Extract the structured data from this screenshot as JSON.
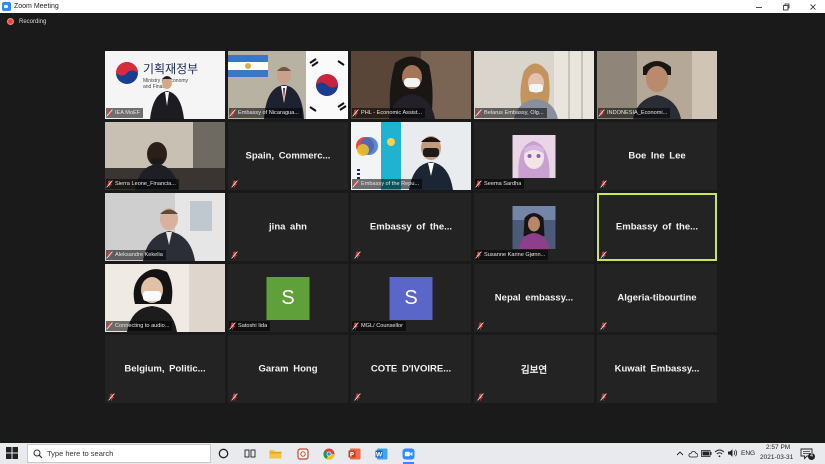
{
  "window": {
    "title": "Zoom Meeting"
  },
  "recording": {
    "label": "Recording",
    "color": "#e8473b"
  },
  "accent": {
    "active_speaker_border": "#c8e65a",
    "zoom_blue": "#2d8cff"
  },
  "tiles": [
    {
      "kind": "video",
      "scene": "ministry-logo",
      "caption": "IEA MoEF",
      "logo_text": "기획재정부",
      "logo_sub_1": "Ministry of Economy",
      "logo_sub_2": "and Finance"
    },
    {
      "kind": "video",
      "scene": "flags",
      "caption": "Embassy of Nicaragua..."
    },
    {
      "kind": "video",
      "scene": "woman-mask",
      "caption": "PHL - Economic Assist..."
    },
    {
      "kind": "video",
      "scene": "woman-room",
      "caption": "Belarus Embassy, Olg..."
    },
    {
      "kind": "video",
      "scene": "man-office",
      "caption": "INDONESIA_Economi..."
    },
    {
      "kind": "video",
      "scene": "man-dark",
      "caption": "Sierra Leone_Financia..."
    },
    {
      "kind": "name",
      "display": "Spain, Commerc..."
    },
    {
      "kind": "video",
      "scene": "man-flag-kz",
      "caption": "Embassy of the Repu..."
    },
    {
      "kind": "thumb",
      "scene": "anime",
      "caption": "Seema Sardha"
    },
    {
      "kind": "name",
      "display": "Boe Ine Lee"
    },
    {
      "kind": "video",
      "scene": "man-office-2",
      "caption": "Aleksandre Kekelia"
    },
    {
      "kind": "name",
      "display": "jina ahn"
    },
    {
      "kind": "name",
      "display": "Embassy of the..."
    },
    {
      "kind": "thumb",
      "scene": "woman-photo",
      "caption": "Susanne Karine Gjønn..."
    },
    {
      "kind": "name",
      "display": "Embassy of the...",
      "active": true
    },
    {
      "kind": "video",
      "scene": "woman-mask-2",
      "caption": "Connecting to audio..."
    },
    {
      "kind": "avatar",
      "letter": "S",
      "avatar_color": "#5fa03a",
      "caption": "Satoshi Iida"
    },
    {
      "kind": "avatar",
      "letter": "S",
      "avatar_color": "#5a67c8",
      "caption": "MGL/ Counsellor"
    },
    {
      "kind": "name",
      "display": "Nepal embassy..."
    },
    {
      "kind": "name",
      "display": "Algeria-tibourtine"
    },
    {
      "kind": "name",
      "display": "Belgium, Politic..."
    },
    {
      "kind": "name",
      "display": "Garam Hong"
    },
    {
      "kind": "name",
      "display": "COTE D'IVOIRE..."
    },
    {
      "kind": "name",
      "display": "김보연"
    },
    {
      "kind": "name",
      "display": "Kuwait Embassy..."
    }
  ],
  "taskbar": {
    "search_placeholder": "Type here to search",
    "pinned": [
      "cortana-icon",
      "task-view-icon",
      "file-explorer-icon",
      "snip-icon",
      "chrome-icon",
      "powerpoint-icon",
      "word-icon",
      "zoom-icon"
    ],
    "language": "ENG",
    "time": "2:57 PM",
    "date": "2021-03-31",
    "notification_count": "4"
  }
}
